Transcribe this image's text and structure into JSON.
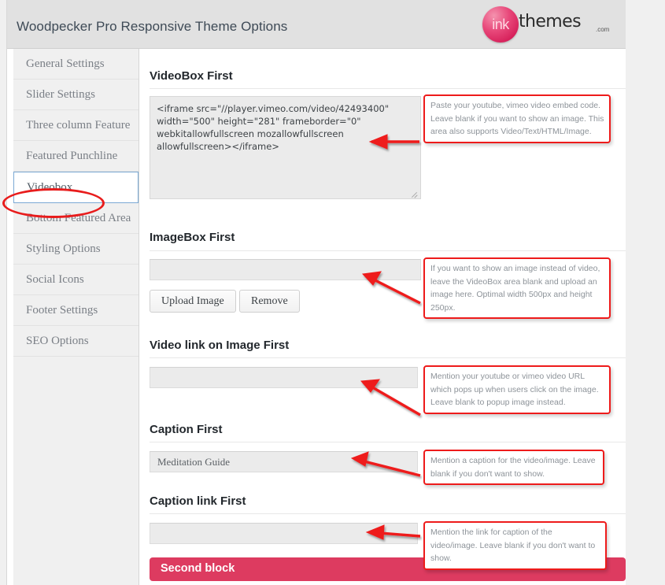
{
  "header": {
    "title": "Woodpecker Pro Responsive Theme Options",
    "logo": {
      "mark": "ink",
      "word": "themes",
      "suffix": ".com",
      "color": "#d6205a"
    }
  },
  "sidebar": {
    "active": "Videobox",
    "items": [
      {
        "label": "General Settings",
        "active": false
      },
      {
        "label": "Slider Settings",
        "active": false
      },
      {
        "label": "Three column Feature",
        "active": false
      },
      {
        "label": "Featured Punchline",
        "active": false
      },
      {
        "label": "Videobox",
        "active": true
      },
      {
        "label": "Bottom Featured Area",
        "active": false
      },
      {
        "label": "Styling Options",
        "active": false
      },
      {
        "label": "Social Icons",
        "active": false
      },
      {
        "label": "Footer Settings",
        "active": false
      },
      {
        "label": "SEO Options",
        "active": false
      }
    ]
  },
  "sections": {
    "videobox": {
      "title": "VideoBox First",
      "value": "<iframe src=\"//player.vimeo.com/video/42493400\" width=\"500\" height=\"281\" frameborder=\"0\" webkitallowfullscreen mozallowfullscreen allowfullscreen></iframe>",
      "placeholder": "",
      "hint": "Paste your youtube, vimeo video embed code. Leave blank if you want to show an image. This area also supports Video/Text/HTML/Image."
    },
    "imagebox": {
      "title": "ImageBox First",
      "value": "",
      "placeholder": "",
      "upload_label": "Upload Image",
      "remove_label": "Remove",
      "hint": "If you want to show an image instead of video, leave the VideoBox area blank and upload an image here. Optimal width 500px and height 250px."
    },
    "video_link": {
      "title": "Video link on Image First",
      "value": "",
      "placeholder": "",
      "hint": "Mention your youtube or vimeo video URL which pops up when users click on the image. Leave blank to popup image instead."
    },
    "caption": {
      "title": "Caption First",
      "value": "Meditation Guide",
      "placeholder": "",
      "hint": "Mention a caption for the video/image. Leave blank if you don't want to show."
    },
    "caption_link": {
      "title": "Caption link First",
      "value": "",
      "placeholder": "",
      "hint": "Mention the link for caption of the video/image. Leave blank if you don't want to show."
    },
    "second_block": {
      "label": "Second block",
      "color": "#dd3b60"
    }
  },
  "annotations": {
    "marker_color": "#ee1b1b",
    "ellipse_target": "Videobox",
    "arrow_count": 5
  }
}
